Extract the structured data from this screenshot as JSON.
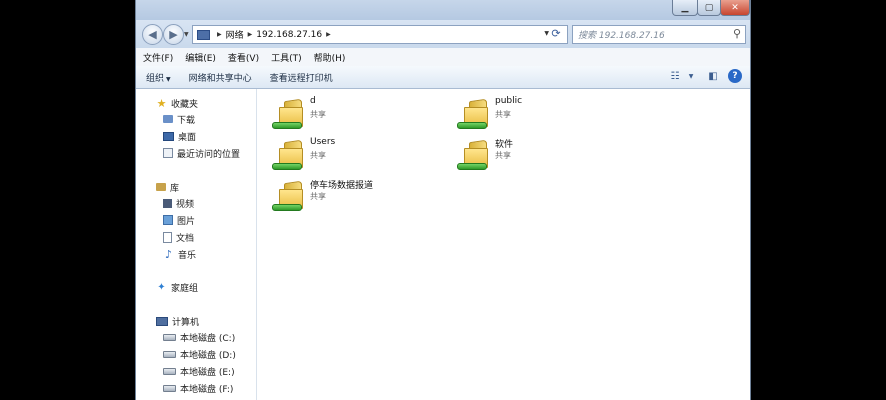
{
  "window": {
    "controls": {
      "minimize": "▁",
      "maximize": "▢",
      "close": "✕"
    }
  },
  "navbar": {
    "breadcrumbs": [
      "网络",
      "192.168.27.16"
    ],
    "search_placeholder": "搜索 192.168.27.16"
  },
  "menubar": {
    "items": [
      "文件(F)",
      "编辑(E)",
      "查看(V)",
      "工具(T)",
      "帮助(H)"
    ]
  },
  "cmdbar": {
    "organize": "组织",
    "network_center": "网络和共享中心",
    "remote_printers": "查看远程打印机"
  },
  "navpane": {
    "favorites": "收藏夹",
    "downloads": "下载",
    "desktop": "桌面",
    "recent": "最近访问的位置",
    "libraries": "库",
    "videos": "视频",
    "pictures": "图片",
    "documents": "文档",
    "music": "音乐",
    "homegroup": "家庭组",
    "computer": "计算机",
    "drives": [
      "本地磁盘 (C:)",
      "本地磁盘 (D:)",
      "本地磁盘 (E:)",
      "本地磁盘 (F:)"
    ]
  },
  "content": {
    "shares": [
      {
        "name": "d",
        "type": "共享"
      },
      {
        "name": "public",
        "type": "共享"
      },
      {
        "name": "Users",
        "type": "共享"
      },
      {
        "name": "软件",
        "type": "共享"
      },
      {
        "name": "停车场数据报道",
        "type": "共享"
      }
    ]
  },
  "colors": {
    "chrome": "#dfe9f5",
    "accent": "#2a69c7",
    "folder": "#f6dc7f"
  },
  "icons": [
    "search-icon",
    "refresh-icon",
    "back-arrow-icon",
    "forward-arrow-icon",
    "help-icon",
    "views-icon",
    "preview-pane-icon",
    "shared-folder-icon"
  ]
}
